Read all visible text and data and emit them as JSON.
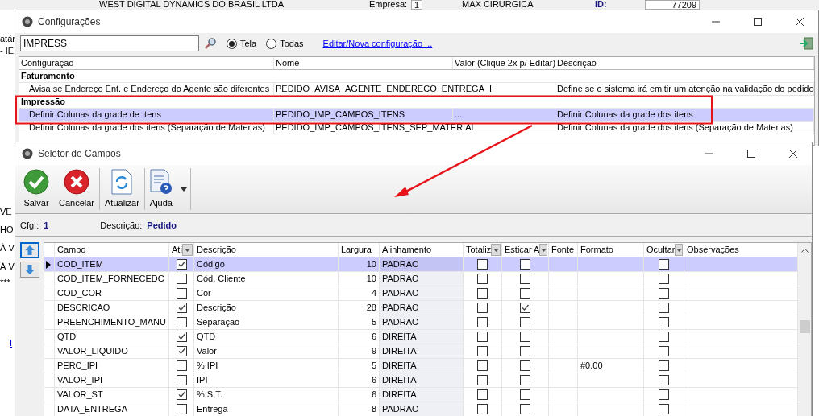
{
  "background_app": {
    "header": [
      "WEST DIGITAL DYNAMICS DO BRASIL LTDA",
      "Empresa:",
      "1",
      "MAX CIRURGICA",
      "ID:",
      "77209"
    ],
    "side_texts": [
      "atár",
      "- IE",
      "VE",
      "HO",
      "À V",
      "À V",
      "***"
    ],
    "side_link": "I"
  },
  "config_window": {
    "title": "Configurações",
    "search": {
      "value": "IMPRESS"
    },
    "scope": [
      {
        "label": "Tela",
        "selected": true
      },
      {
        "label": "Todas",
        "selected": false
      }
    ],
    "link": "Editar/Nova configuração ...",
    "columns": [
      "Configuração",
      "Nome",
      "Valor (Clique 2x p/ Editar)",
      "Descrição"
    ],
    "rows": [
      {
        "kind": "group",
        "label": "Faturamento"
      },
      {
        "kind": "item",
        "selected": false,
        "cells": [
          "Avisa se Endereço Ent. e Endereço do Agente são diferentes",
          "PEDIDO_AVISA_AGENTE_ENDERECO_ENTREGA_I",
          "",
          "Define se o sistema irá emitir um atenção na validação do pedido"
        ]
      },
      {
        "kind": "group",
        "label": "Impressão"
      },
      {
        "kind": "item",
        "selected": true,
        "cells": [
          "Definir Colunas da grade de Itens",
          "PEDIDO_IMP_CAMPOS_ITENS",
          "...",
          "Definir Colunas da grade dos itens"
        ]
      },
      {
        "kind": "item",
        "selected": false,
        "cells": [
          "Definir Colunas da grade dos itens (Separação de Materias)",
          "PEDIDO_IMP_CAMPOS_ITENS_SEP_MATERIAL",
          "",
          "Definir Colunas da grade dos itens (Separação de Materias)"
        ]
      }
    ]
  },
  "selector_window": {
    "title": "Seletor de Campos",
    "toolbar": [
      {
        "kind": "save",
        "label": "Salvar",
        "menu": false
      },
      {
        "kind": "cancel",
        "label": "Cancelar",
        "menu": false
      },
      {
        "kind": "refresh",
        "label": "Atualizar",
        "menu": false
      },
      {
        "kind": "help",
        "label": "Ajuda",
        "menu": true
      }
    ],
    "info": {
      "cfg_label": "Cfg.:",
      "cfg": "1",
      "desc_label": "Descrição:",
      "desc": "Pedido"
    },
    "columns": [
      {
        "label": "Campo",
        "filter": false
      },
      {
        "label": "Ati",
        "filter": true
      },
      {
        "label": "Descrição",
        "filter": false
      },
      {
        "label": "Largura",
        "filter": false
      },
      {
        "label": "Alinhamento",
        "filter": false
      },
      {
        "label": "Totaliz",
        "filter": true
      },
      {
        "label": "Esticar A",
        "filter": true
      },
      {
        "label": "Fonte",
        "filter": false
      },
      {
        "label": "Formato",
        "filter": false
      },
      {
        "label": "Ocultar",
        "filter": true
      },
      {
        "label": "Observações",
        "filter": false
      }
    ],
    "rows": [
      {
        "campo": "COD_ITEM",
        "ativo": true,
        "descricao": "Código",
        "largura": "10",
        "alinhamento": "PADRAO",
        "totalizar": false,
        "esticar": false,
        "formato": "",
        "ocultar": false,
        "selected": true
      },
      {
        "campo": "COD_ITEM_FORNECEDC",
        "ativo": false,
        "descricao": "Cód. Cliente",
        "largura": "10",
        "alinhamento": "PADRAO",
        "totalizar": false,
        "esticar": false,
        "formato": "",
        "ocultar": false,
        "selected": false
      },
      {
        "campo": "COD_COR",
        "ativo": false,
        "descricao": "Cor",
        "largura": "4",
        "alinhamento": "PADRAO",
        "totalizar": false,
        "esticar": false,
        "formato": "",
        "ocultar": false,
        "selected": false
      },
      {
        "campo": "DESCRICAO",
        "ativo": true,
        "descricao": "Descrição",
        "largura": "28",
        "alinhamento": "PADRAO",
        "totalizar": false,
        "esticar": true,
        "formato": "",
        "ocultar": false,
        "selected": false
      },
      {
        "campo": "PREENCHIMENTO_MANU",
        "ativo": false,
        "descricao": "Separação",
        "largura": "5",
        "alinhamento": "PADRAO",
        "totalizar": false,
        "esticar": false,
        "formato": "",
        "ocultar": false,
        "selected": false
      },
      {
        "campo": "QTD",
        "ativo": true,
        "descricao": "QTD",
        "largura": "6",
        "alinhamento": "DIREITA",
        "totalizar": false,
        "esticar": false,
        "formato": "",
        "ocultar": false,
        "selected": false
      },
      {
        "campo": "VALOR_LIQUIDO",
        "ativo": true,
        "descricao": "Valor",
        "largura": "9",
        "alinhamento": "DIREITA",
        "totalizar": false,
        "esticar": false,
        "formato": "",
        "ocultar": false,
        "selected": false
      },
      {
        "campo": "PERC_IPI",
        "ativo": false,
        "descricao": "% IPI",
        "largura": "5",
        "alinhamento": "DIREITA",
        "totalizar": false,
        "esticar": false,
        "formato": "#0.00",
        "ocultar": false,
        "selected": false
      },
      {
        "campo": "VALOR_IPI",
        "ativo": false,
        "descricao": "IPI",
        "largura": "6",
        "alinhamento": "DIREITA",
        "totalizar": false,
        "esticar": false,
        "formato": "",
        "ocultar": false,
        "selected": false
      },
      {
        "campo": "VALOR_ST",
        "ativo": true,
        "descricao": "% S.T.",
        "largura": "6",
        "alinhamento": "DIREITA",
        "totalizar": false,
        "esticar": false,
        "formato": "",
        "ocultar": false,
        "selected": false
      },
      {
        "campo": "DATA_ENTREGA",
        "ativo": false,
        "descricao": "Entrega",
        "largura": "8",
        "alinhamento": "PADRAO",
        "totalizar": false,
        "esticar": false,
        "formato": "",
        "ocultar": false,
        "selected": false
      }
    ]
  }
}
